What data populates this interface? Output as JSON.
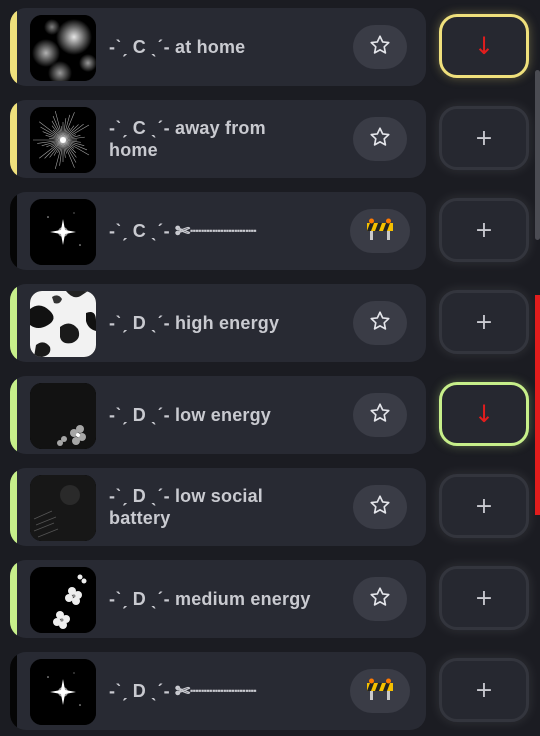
{
  "colors": {
    "accent_yellow": "#efe07c",
    "accent_green": "#c7ef8a",
    "arrow_red": "#e11d1d",
    "plus_gray": "#c9cad0",
    "background": "#1b1c22",
    "card": "#282a33"
  },
  "rows": [
    {
      "prefix": "-ˋˏ C ˎˊ-",
      "name": "at home",
      "line2": "",
      "thumb": "bokeh",
      "accent": "yellow",
      "badge": "star-icon",
      "action": "down-arrow-icon",
      "action_glyph": "↓",
      "action_border": "yellow"
    },
    {
      "prefix": "-ˋˏ C ˎˊ-",
      "name": "away from",
      "line2": "home",
      "thumb": "firework",
      "accent": "yellow",
      "badge": "star-icon",
      "action": "plus-icon",
      "action_glyph": "+",
      "action_border": "none"
    },
    {
      "prefix": "-ˋˏ C ˎˊ-",
      "name": "✄┈┈┈┈┈┈",
      "line2": "",
      "thumb": "sparkle",
      "accent": "black",
      "badge": "construction-icon",
      "action": "plus-icon",
      "action_glyph": "+",
      "action_border": "none"
    },
    {
      "prefix": "-ˋˏ D ˎˊ-",
      "name": "high energy",
      "line2": "",
      "thumb": "clouds",
      "accent": "green",
      "badge": "star-icon",
      "action": "plus-icon",
      "action_glyph": "+",
      "action_border": "none"
    },
    {
      "prefix": "-ˋˏ D ˎˊ-",
      "name": "low energy",
      "line2": "",
      "thumb": "dark-flowers",
      "accent": "green",
      "badge": "star-icon",
      "action": "down-arrow-icon",
      "action_glyph": "↓",
      "action_border": "green"
    },
    {
      "prefix": "-ˋˏ D ˎˊ-",
      "name": "low social",
      "line2": "battery",
      "thumb": "dark-texture",
      "accent": "green",
      "badge": "star-icon",
      "action": "plus-icon",
      "action_glyph": "+",
      "action_border": "none"
    },
    {
      "prefix": "-ˋˏ D ˎˊ-",
      "name": "medium energy",
      "line2": "",
      "thumb": "white-flowers",
      "accent": "green",
      "badge": "star-icon",
      "action": "plus-icon",
      "action_glyph": "+",
      "action_border": "none"
    },
    {
      "prefix": "-ˋˏ D ˎˊ-",
      "name": "✄┈┈┈┈┈┈",
      "line2": "",
      "thumb": "sparkle",
      "accent": "black",
      "badge": "construction-icon",
      "action": "plus-icon",
      "action_glyph": "+",
      "action_border": "none"
    }
  ]
}
